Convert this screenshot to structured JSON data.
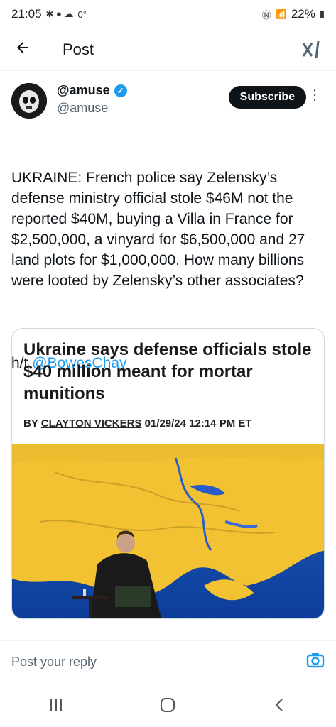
{
  "status_bar": {
    "time": "21:05",
    "temp": "0°",
    "battery": "22%"
  },
  "header": {
    "title": "Post"
  },
  "tweet": {
    "author_name": "@amuse",
    "author_handle": "@amuse",
    "subscribe_label": "Subscribe",
    "text": "UKRAINE: French police say Zelensky’s defense ministry official stole $46M not the reported $40M, buying a Villa in France for $2,500,000, a vinyard for $6,500,000 and 27 land plots for $1,000,000. How many billions were looted by Zelensky’s other associates?",
    "ht_prefix": "h/t ",
    "ht_mention": "@BowesChay"
  },
  "card": {
    "headline": "Ukraine says defense officials stole $40 million meant for mortar munitions",
    "byline_prefix": "BY ",
    "byline_author": "CLAYTON VICKERS",
    "byline_date": " 01/29/24 12:14 PM ET"
  },
  "reply": {
    "placeholder": "Post your reply"
  },
  "colors": {
    "accent": "#1d9bf0",
    "text": "#0f1419",
    "muted": "#536471"
  },
  "icons": [
    "back-arrow-icon",
    "grok-icon",
    "verified-icon",
    "more-icon",
    "camera-icon",
    "recent-apps-icon",
    "home-icon",
    "back-nav-icon"
  ]
}
